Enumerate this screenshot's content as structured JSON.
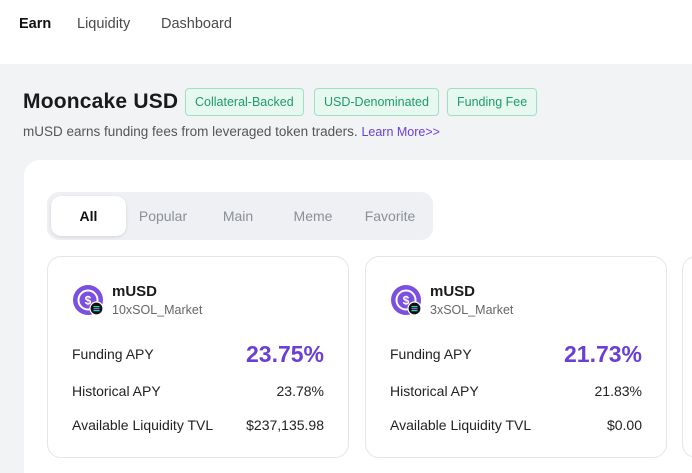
{
  "nav": {
    "items": [
      "Earn",
      "Liquidity",
      "Dashboard"
    ],
    "active": "Earn"
  },
  "header": {
    "title": "Mooncake USD",
    "badges": [
      "Collateral-Backed",
      "USD-Denominated",
      "Funding Fee"
    ],
    "subtitle": "mUSD earns funding fees from leveraged token traders.",
    "learn_more": "Learn More>>"
  },
  "tabs": {
    "items": [
      "All",
      "Popular",
      "Main",
      "Meme",
      "Favorite"
    ],
    "active": "All"
  },
  "cards": [
    {
      "name": "mUSD",
      "market": "10xSOL_Market",
      "funding_label": "Funding APY",
      "funding_value": "23.75%",
      "historical_label": "Historical APY",
      "historical_value": "23.78%",
      "tvl_label": "Available Liquidity TVL",
      "tvl_value": "$237,135.98"
    },
    {
      "name": "mUSD",
      "market": "3xSOL_Market",
      "funding_label": "Funding APY",
      "funding_value": "21.73%",
      "historical_label": "Historical APY",
      "historical_value": "21.83%",
      "tvl_label": "Available Liquidity TVL",
      "tvl_value": "$0.00"
    }
  ],
  "colors": {
    "accent": "#6a3fd6",
    "badge_text": "#1d9c6a",
    "badge_bg": "#e6f8ef",
    "icon_bg": "#7b4fe0"
  },
  "icons": {
    "token": "musd-token-icon",
    "chain": "solana-icon"
  }
}
